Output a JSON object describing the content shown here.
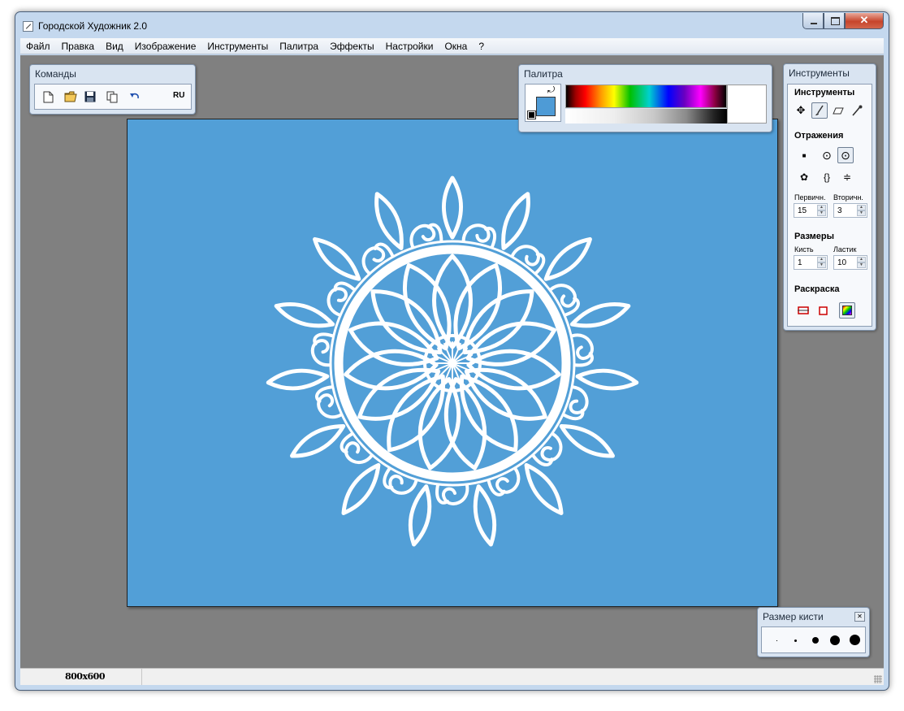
{
  "window": {
    "title": "Городской Художник 2.0"
  },
  "menu": [
    "Файл",
    "Правка",
    "Вид",
    "Изображение",
    "Инструменты",
    "Палитра",
    "Эффекты",
    "Настройки",
    "Окна",
    "?"
  ],
  "commands_panel": {
    "title": "Команды",
    "icons": [
      "new-file-icon",
      "open-folder-icon",
      "save-disk-icon",
      "copy-icon",
      "undo-icon"
    ],
    "lang": "RU"
  },
  "palette_panel": {
    "title": "Палитра",
    "primary_color": "#4e9bd6",
    "secondary_color": "#000000"
  },
  "tools_panel": {
    "title": "Инструменты",
    "tools_heading": "Инструменты",
    "tools": [
      "move-icon",
      "brush-icon",
      "eraser-icon",
      "eyedropper-icon"
    ],
    "reflections_heading": "Отражения",
    "primary_label": "Первичн.",
    "secondary_label": "Вторичн.",
    "primary_value": "15",
    "secondary_value": "3",
    "sizes_heading": "Размеры",
    "brush_label": "Кисть",
    "eraser_label": "Ластик",
    "brush_value": "1",
    "eraser_value": "10",
    "fill_heading": "Раскраска"
  },
  "brush_size_panel": {
    "title": "Размер кисти"
  },
  "canvas": {
    "background": "#529fd7"
  },
  "status": {
    "dimensions": "800x600"
  }
}
